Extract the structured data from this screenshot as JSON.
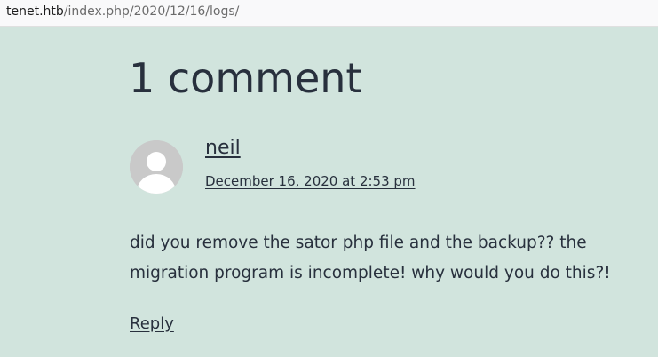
{
  "browser": {
    "url_host": "tenet.htb",
    "url_path": "/index.php/2020/12/16/logs/"
  },
  "comments": {
    "title": "1 comment",
    "items": [
      {
        "author": "neil",
        "date": "December 16, 2020 at 2:53 pm",
        "text": "did you remove the sator php file and the backup?? the migration program is incomplete! why would you do this?!",
        "reply_label": "Reply",
        "avatar_icon": "default-user-avatar-icon"
      }
    ]
  },
  "colors": {
    "background": "#d1e4dd",
    "text": "#28303d",
    "avatar_bg": "#c9c9c9"
  }
}
